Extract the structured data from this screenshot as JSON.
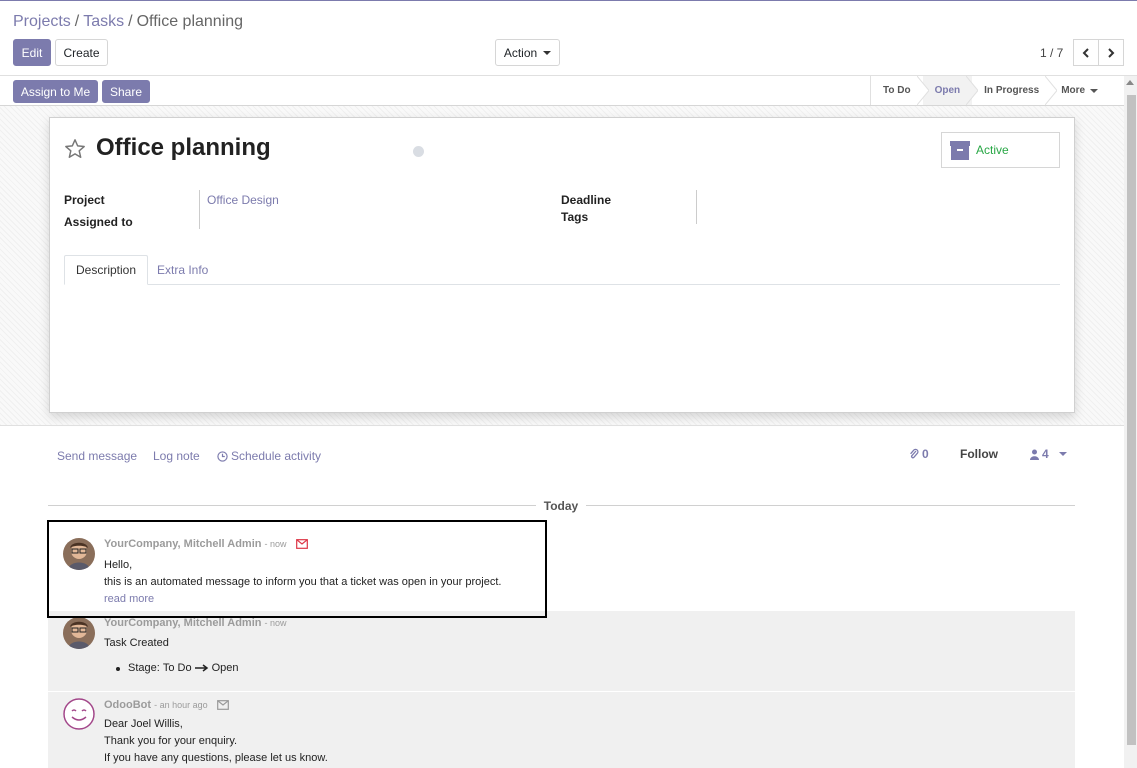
{
  "breadcrumb": {
    "projects": "Projects",
    "tasks": "Tasks",
    "current": "Office planning",
    "sep": "/"
  },
  "toolbar": {
    "edit": "Edit",
    "create": "Create",
    "action": "Action",
    "pager": "1 / 7"
  },
  "statusbar": {
    "assign_to_me": "Assign to Me",
    "share": "Share",
    "stages": [
      "To Do",
      "Open",
      "In Progress"
    ],
    "active_stage": "Open",
    "more": "More"
  },
  "form": {
    "title": "Office planning",
    "active_label": "Active",
    "project_label": "Project",
    "project_value": "Office Design",
    "assigned_label": "Assigned to",
    "deadline_label": "Deadline",
    "tags_label": "Tags",
    "tabs": [
      "Description",
      "Extra Info"
    ]
  },
  "chatter": {
    "send_message": "Send message",
    "log_note": "Log note",
    "schedule_activity": "Schedule activity",
    "attachments_count": "0",
    "follow": "Follow",
    "followers_count": "4",
    "today": "Today",
    "messages": [
      {
        "author": "YourCompany, Mitchell Admin",
        "date": "- now",
        "lines": [
          "Hello,",
          "this is an automated message to inform you that a ticket was open in your project."
        ],
        "read_more": "read more"
      },
      {
        "author": "YourCompany, Mitchell Admin",
        "date": "- now",
        "body": "Task Created",
        "tracking": {
          "field": "Stage:",
          "old": "To Do",
          "new": "Open"
        }
      },
      {
        "author": "OdooBot",
        "date": "- an hour ago",
        "lines": [
          "Dear Joel Willis,",
          "Thank you for your enquiry.",
          "If you have any questions, please let us know."
        ]
      }
    ]
  },
  "colors": {
    "brand": "#7c7bad",
    "active_green": "#28a745"
  }
}
